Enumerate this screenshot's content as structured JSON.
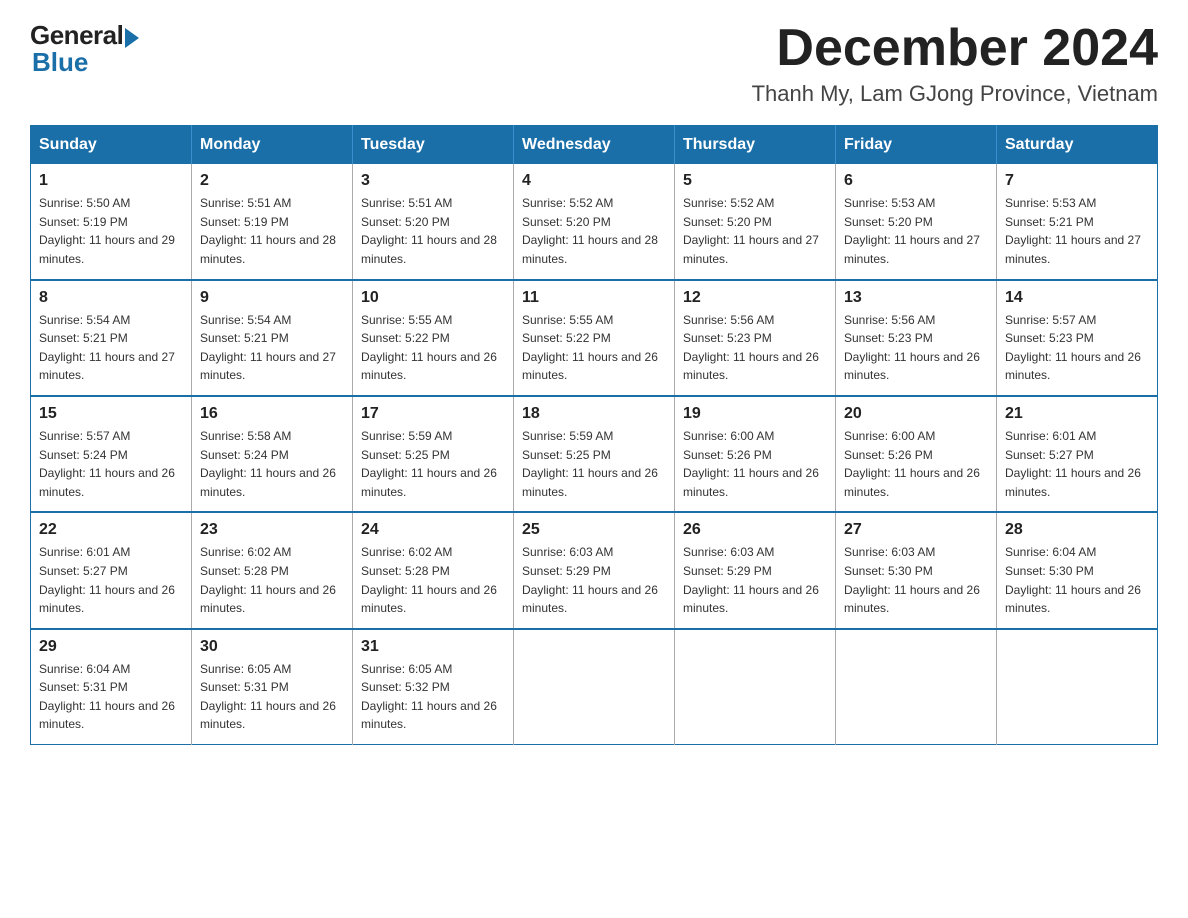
{
  "logo": {
    "general": "General",
    "blue": "Blue"
  },
  "header": {
    "title": "December 2024",
    "subtitle": "Thanh My, Lam GJong Province, Vietnam"
  },
  "days_of_week": [
    "Sunday",
    "Monday",
    "Tuesday",
    "Wednesday",
    "Thursday",
    "Friday",
    "Saturday"
  ],
  "weeks": [
    [
      {
        "day": "1",
        "sunrise": "5:50 AM",
        "sunset": "5:19 PM",
        "daylight": "11 hours and 29 minutes."
      },
      {
        "day": "2",
        "sunrise": "5:51 AM",
        "sunset": "5:19 PM",
        "daylight": "11 hours and 28 minutes."
      },
      {
        "day": "3",
        "sunrise": "5:51 AM",
        "sunset": "5:20 PM",
        "daylight": "11 hours and 28 minutes."
      },
      {
        "day": "4",
        "sunrise": "5:52 AM",
        "sunset": "5:20 PM",
        "daylight": "11 hours and 28 minutes."
      },
      {
        "day": "5",
        "sunrise": "5:52 AM",
        "sunset": "5:20 PM",
        "daylight": "11 hours and 27 minutes."
      },
      {
        "day": "6",
        "sunrise": "5:53 AM",
        "sunset": "5:20 PM",
        "daylight": "11 hours and 27 minutes."
      },
      {
        "day": "7",
        "sunrise": "5:53 AM",
        "sunset": "5:21 PM",
        "daylight": "11 hours and 27 minutes."
      }
    ],
    [
      {
        "day": "8",
        "sunrise": "5:54 AM",
        "sunset": "5:21 PM",
        "daylight": "11 hours and 27 minutes."
      },
      {
        "day": "9",
        "sunrise": "5:54 AM",
        "sunset": "5:21 PM",
        "daylight": "11 hours and 27 minutes."
      },
      {
        "day": "10",
        "sunrise": "5:55 AM",
        "sunset": "5:22 PM",
        "daylight": "11 hours and 26 minutes."
      },
      {
        "day": "11",
        "sunrise": "5:55 AM",
        "sunset": "5:22 PM",
        "daylight": "11 hours and 26 minutes."
      },
      {
        "day": "12",
        "sunrise": "5:56 AM",
        "sunset": "5:23 PM",
        "daylight": "11 hours and 26 minutes."
      },
      {
        "day": "13",
        "sunrise": "5:56 AM",
        "sunset": "5:23 PM",
        "daylight": "11 hours and 26 minutes."
      },
      {
        "day": "14",
        "sunrise": "5:57 AM",
        "sunset": "5:23 PM",
        "daylight": "11 hours and 26 minutes."
      }
    ],
    [
      {
        "day": "15",
        "sunrise": "5:57 AM",
        "sunset": "5:24 PM",
        "daylight": "11 hours and 26 minutes."
      },
      {
        "day": "16",
        "sunrise": "5:58 AM",
        "sunset": "5:24 PM",
        "daylight": "11 hours and 26 minutes."
      },
      {
        "day": "17",
        "sunrise": "5:59 AM",
        "sunset": "5:25 PM",
        "daylight": "11 hours and 26 minutes."
      },
      {
        "day": "18",
        "sunrise": "5:59 AM",
        "sunset": "5:25 PM",
        "daylight": "11 hours and 26 minutes."
      },
      {
        "day": "19",
        "sunrise": "6:00 AM",
        "sunset": "5:26 PM",
        "daylight": "11 hours and 26 minutes."
      },
      {
        "day": "20",
        "sunrise": "6:00 AM",
        "sunset": "5:26 PM",
        "daylight": "11 hours and 26 minutes."
      },
      {
        "day": "21",
        "sunrise": "6:01 AM",
        "sunset": "5:27 PM",
        "daylight": "11 hours and 26 minutes."
      }
    ],
    [
      {
        "day": "22",
        "sunrise": "6:01 AM",
        "sunset": "5:27 PM",
        "daylight": "11 hours and 26 minutes."
      },
      {
        "day": "23",
        "sunrise": "6:02 AM",
        "sunset": "5:28 PM",
        "daylight": "11 hours and 26 minutes."
      },
      {
        "day": "24",
        "sunrise": "6:02 AM",
        "sunset": "5:28 PM",
        "daylight": "11 hours and 26 minutes."
      },
      {
        "day": "25",
        "sunrise": "6:03 AM",
        "sunset": "5:29 PM",
        "daylight": "11 hours and 26 minutes."
      },
      {
        "day": "26",
        "sunrise": "6:03 AM",
        "sunset": "5:29 PM",
        "daylight": "11 hours and 26 minutes."
      },
      {
        "day": "27",
        "sunrise": "6:03 AM",
        "sunset": "5:30 PM",
        "daylight": "11 hours and 26 minutes."
      },
      {
        "day": "28",
        "sunrise": "6:04 AM",
        "sunset": "5:30 PM",
        "daylight": "11 hours and 26 minutes."
      }
    ],
    [
      {
        "day": "29",
        "sunrise": "6:04 AM",
        "sunset": "5:31 PM",
        "daylight": "11 hours and 26 minutes."
      },
      {
        "day": "30",
        "sunrise": "6:05 AM",
        "sunset": "5:31 PM",
        "daylight": "11 hours and 26 minutes."
      },
      {
        "day": "31",
        "sunrise": "6:05 AM",
        "sunset": "5:32 PM",
        "daylight": "11 hours and 26 minutes."
      },
      null,
      null,
      null,
      null
    ]
  ]
}
